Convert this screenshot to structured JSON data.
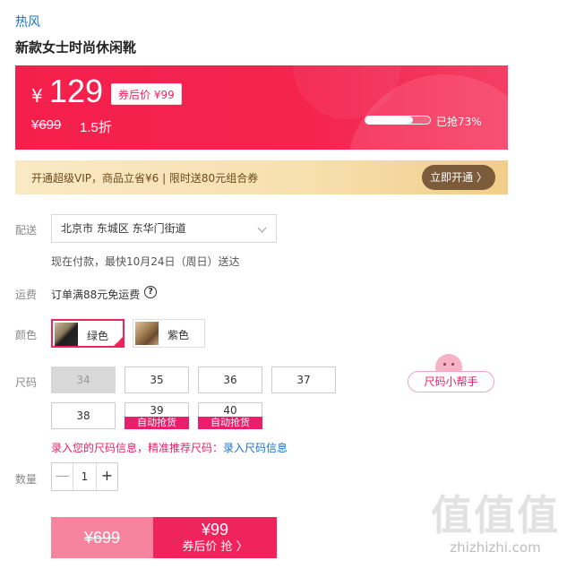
{
  "store": {
    "brand": "热风"
  },
  "product": {
    "title": "新款女士时尚休闲靴"
  },
  "price": {
    "currency": "¥",
    "current": "129",
    "coupon_tag": "券后价 ¥99",
    "original": "¥699",
    "discount": "1.5折",
    "sold_label": "已抢73%",
    "sold_fraction": 0.73
  },
  "vip": {
    "text": "开通超级VIP，商品立省¥6 | 限时送80元组合券",
    "button": "立即开通 〉"
  },
  "delivery": {
    "label": "配送",
    "address": "北京市 东城区 东华门街道",
    "note": "现在付款，最快10月24日（周日）送达"
  },
  "shipping": {
    "label": "运费",
    "text": "订单满88元免运费",
    "help": "?"
  },
  "color": {
    "label": "颜色",
    "options": [
      {
        "name": "绿色",
        "selected": true
      },
      {
        "name": "紫色",
        "selected": false
      }
    ]
  },
  "size": {
    "label": "尺码",
    "helper": "尺码小帮手",
    "options": [
      {
        "value": "34",
        "state": "disabled"
      },
      {
        "value": "35",
        "state": "available"
      },
      {
        "value": "36",
        "state": "available"
      },
      {
        "value": "37",
        "state": "available"
      },
      {
        "value": "38",
        "state": "available"
      },
      {
        "value": "39",
        "state": "restock",
        "tag": "自动抢货"
      },
      {
        "value": "40",
        "state": "restock",
        "tag": "自动抢货"
      }
    ],
    "tip": "录入您的尺码信息，精准推荐尺码：",
    "tip_link": "录入尺码信息"
  },
  "quantity": {
    "label": "数量",
    "value": "1",
    "minus": "—",
    "plus": "+"
  },
  "buy": {
    "original": "¥699",
    "price": "¥99",
    "action": "券后价 抢 〉"
  },
  "watermark": {
    "big": "值值值",
    "small": "zhizhizhi.com"
  },
  "colors": {
    "accent": "#f0245c",
    "link": "#1a73c7",
    "vip_button": "#7b5b3a"
  }
}
